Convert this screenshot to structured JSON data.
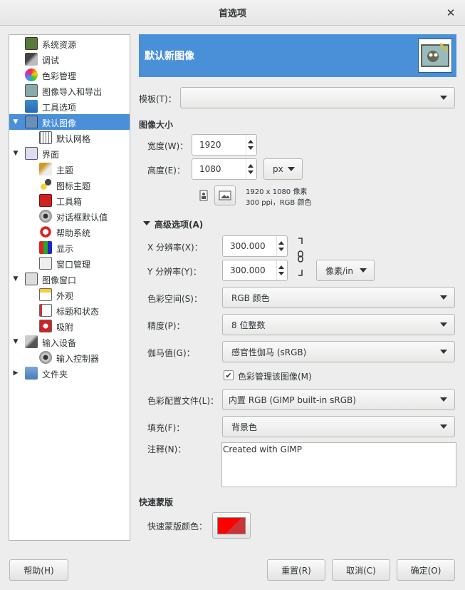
{
  "window": {
    "title": "首选项"
  },
  "sidebar": {
    "items": [
      {
        "label": "系统资源",
        "icon": "system-resources-icon"
      },
      {
        "label": "调试",
        "icon": "debug-icon"
      },
      {
        "label": "色彩管理",
        "icon": "color-management-icon"
      },
      {
        "label": "图像导入和导出",
        "icon": "image-import-export-icon"
      },
      {
        "label": "工具选项",
        "icon": "tool-options-icon"
      },
      {
        "label": "默认图像",
        "icon": "default-image-icon",
        "selected": true,
        "expanded": true
      },
      {
        "label": "默认网格",
        "icon": "default-grid-icon"
      },
      {
        "label": "界面",
        "icon": "interface-icon",
        "expanded": true
      },
      {
        "label": "主题",
        "icon": "theme-icon"
      },
      {
        "label": "图标主题",
        "icon": "icon-theme-icon"
      },
      {
        "label": "工具箱",
        "icon": "toolbox-icon"
      },
      {
        "label": "对话框默认值",
        "icon": "dialog-defaults-icon"
      },
      {
        "label": "帮助系统",
        "icon": "help-system-icon"
      },
      {
        "label": "显示",
        "icon": "display-icon"
      },
      {
        "label": "窗口管理",
        "icon": "window-management-icon"
      },
      {
        "label": "图像窗口",
        "icon": "image-window-icon",
        "expanded": true
      },
      {
        "label": "外观",
        "icon": "appearance-icon"
      },
      {
        "label": "标题和状态",
        "icon": "title-status-icon"
      },
      {
        "label": "吸附",
        "icon": "snapping-icon"
      },
      {
        "label": "输入设备",
        "icon": "input-devices-icon",
        "expanded": true
      },
      {
        "label": "输入控制器",
        "icon": "input-controllers-icon"
      },
      {
        "label": "文件夹",
        "icon": "folders-icon",
        "expanded": false
      }
    ]
  },
  "panel": {
    "title": "默认新图像",
    "template_label": "模板(T)：",
    "template_value": "",
    "image_size_heading": "图像大小",
    "width_label": "宽度(W)：",
    "width_value": "1920",
    "height_label": "高度(E)：",
    "height_value": "1080",
    "unit": "px",
    "size_info": "1920 x 1080 像素",
    "res_info": "300 ppi，RGB 颜色",
    "advanced_label": "高级选项(A)",
    "xres_label": "X 分辨率(X)：",
    "xres_value": "300.000",
    "yres_label": "Y 分辨率(Y)：",
    "yres_value": "300.000",
    "res_unit": "像素/in",
    "colorspace_label": "色彩空间(S)：",
    "colorspace_value": "RGB 颜色",
    "precision_label": "精度(P)：",
    "precision_value": "8 位整数",
    "gamma_label": "伽马值(G)：",
    "gamma_value": "感官性伽马 (sRGB)",
    "color_manage_label": "色彩管理该图像(M)",
    "color_manage_checked": true,
    "profile_label": "色彩配置文件(L)：",
    "profile_value": "内置 RGB (GIMP built-in sRGB)",
    "fill_label": "填充(F)：",
    "fill_value": "背景色",
    "comment_label": "注释(N)：",
    "comment_value": "Created with GIMP",
    "quickmask_heading": "快速蒙版",
    "quickmask_color_label": "快速蒙版颜色：",
    "quickmask_color": "#ff0000"
  },
  "buttons": {
    "help": "帮助(H)",
    "reset": "重置(R)",
    "cancel": "取消(C)",
    "ok": "确定(O)"
  },
  "colors": {
    "selection": "#4a90d9",
    "header": "#4a90d9"
  }
}
